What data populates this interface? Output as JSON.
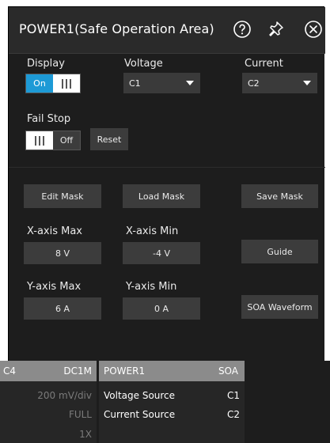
{
  "dialog": {
    "title": "POWER1(Safe Operation Area)",
    "icons": {
      "help": "help-circle-icon",
      "pin": "pin-icon",
      "close": "close-circle-icon"
    }
  },
  "display": {
    "label": "Display",
    "on_label": "On",
    "state": "On"
  },
  "voltage": {
    "label": "Voltage",
    "value": "C1"
  },
  "current": {
    "label": "Current",
    "value": "C2"
  },
  "fail_stop": {
    "label": "Fail Stop",
    "off_label": "Off",
    "state": "Off",
    "reset_label": "Reset"
  },
  "mask": {
    "edit": "Edit Mask",
    "load": "Load Mask",
    "save": "Save Mask"
  },
  "x_axis": {
    "max_label": "X-axis Max",
    "max_value": "8 V",
    "min_label": "X-axis Min",
    "min_value": "-4 V"
  },
  "guide_label": "Guide",
  "y_axis": {
    "max_label": "Y-axis Max",
    "max_value": "6 A",
    "min_label": "Y-axis Min",
    "min_value": "0 A"
  },
  "soa_waveform_label": "SOA Waveform",
  "channel": {
    "name": "C4",
    "coupling": "DC1M",
    "scale": "200 mV/div",
    "bandwidth": "FULL",
    "probe": "1X"
  },
  "power": {
    "name": "POWER1",
    "type": "SOA",
    "voltage_source_label": "Voltage Source",
    "voltage_source": "C1",
    "current_source_label": "Current Source",
    "current_source": "C2"
  },
  "colors": {
    "accent": "#1d9ad6",
    "panel_bg": "#1d1d1d",
    "button_bg": "#3c3c3c",
    "channel_header": "#8b8b8b"
  }
}
